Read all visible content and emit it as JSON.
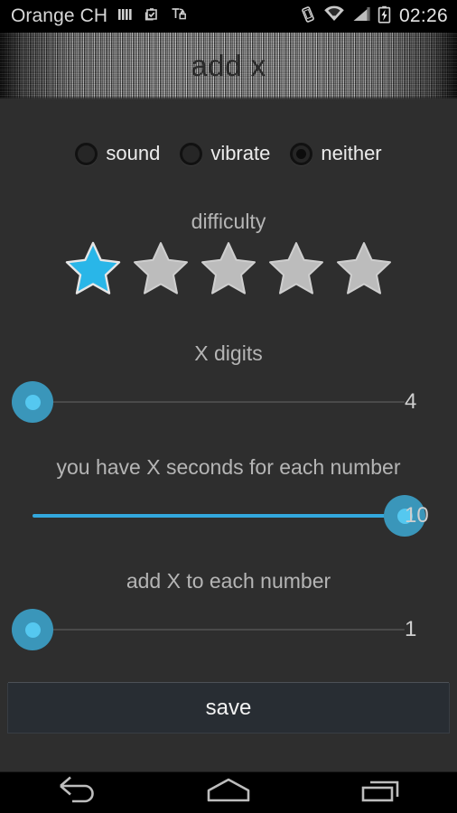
{
  "statusbar": {
    "carrier": "Orange CH",
    "clock": "02:26",
    "left_icons": [
      "signal-bars-icon",
      "clipboard-check-icon",
      "text-lock-icon"
    ],
    "right_icons": [
      "vibrate-icon",
      "wifi-icon",
      "cellular-signal-icon",
      "battery-charging-icon"
    ]
  },
  "titlebar": {
    "title": "add x"
  },
  "feedback": {
    "options": [
      {
        "label": "sound",
        "selected": false
      },
      {
        "label": "vibrate",
        "selected": false
      },
      {
        "label": "neither",
        "selected": true
      }
    ]
  },
  "difficulty": {
    "label": "difficulty",
    "rating": 1,
    "max": 5,
    "filled_color": "#29b6e8",
    "empty_color": "#bdbdbd"
  },
  "sliders": [
    {
      "name": "x-digits",
      "label": "X digits",
      "value": "4",
      "fill_percent": 0
    },
    {
      "name": "seconds-per-number",
      "label": "you have X seconds for each number",
      "value": "10",
      "fill_percent": 100
    },
    {
      "name": "add-to-each-number",
      "label": "add X to each number",
      "value": "1",
      "fill_percent": 0
    }
  ],
  "actions": {
    "save_label": "save"
  },
  "navbar": {
    "buttons": [
      "back-icon",
      "home-icon",
      "recents-icon"
    ]
  },
  "colors": {
    "background": "#2e2e2e",
    "accent": "#33a8dd",
    "thumb_inner": "#55c8f0",
    "thumb_outer": "#3a96ba"
  }
}
